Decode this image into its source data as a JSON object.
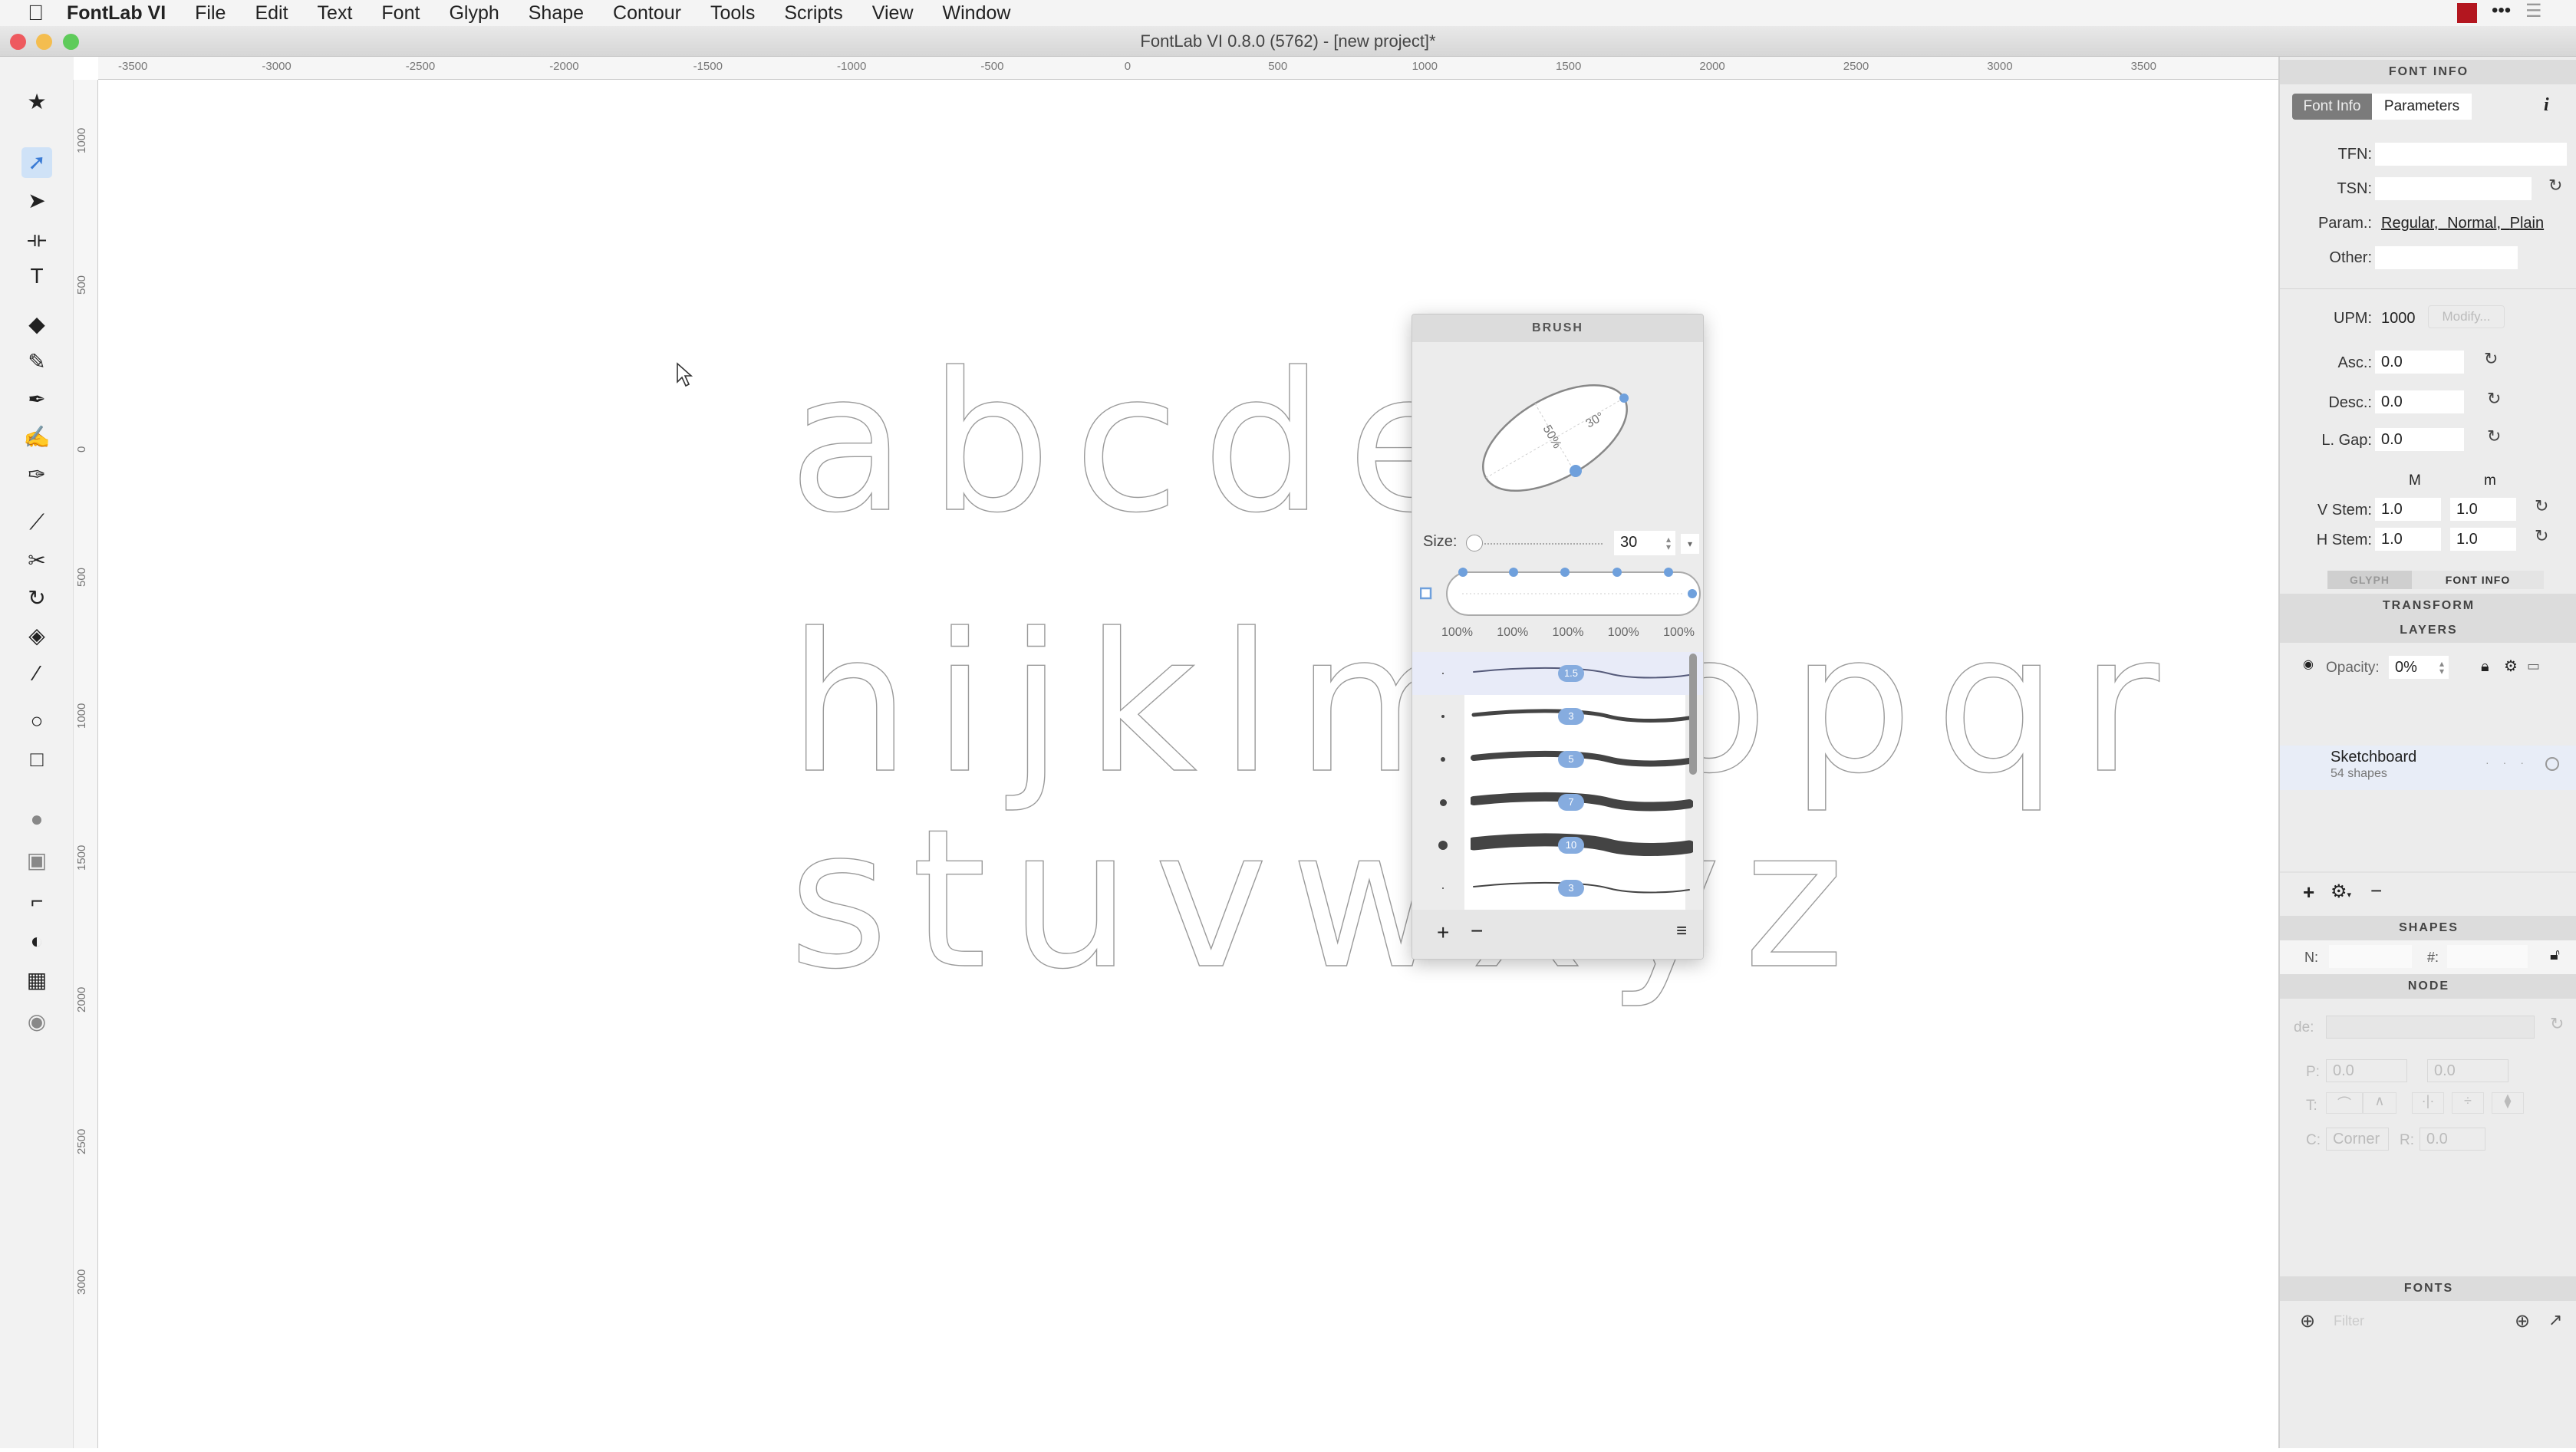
{
  "menubar": {
    "app": "FontLab VI",
    "items": [
      "File",
      "Edit",
      "Text",
      "Font",
      "Glyph",
      "Shape",
      "Contour",
      "Tools",
      "Scripts",
      "View",
      "Window"
    ]
  },
  "window": {
    "title": "FontLab VI 0.8.0 (5762) - [new project]*"
  },
  "rulers": {
    "horizontal": [
      "-3500",
      "-3000",
      "-2500",
      "-2000",
      "-1500",
      "-1000",
      "-500",
      "0",
      "500",
      "1000",
      "1500",
      "2000",
      "2500",
      "3000",
      "3500"
    ],
    "vertical": [
      "1000",
      "500",
      "0",
      "500",
      "1000",
      "1500",
      "2000",
      "2500",
      "3000"
    ]
  },
  "toolbar": {
    "tools": [
      {
        "icon": "star-icon",
        "glyph": "★"
      },
      {
        "icon": "pointer-icon",
        "glyph": "➚",
        "selected": true
      },
      {
        "icon": "contour-pointer-icon",
        "glyph": "➤"
      },
      {
        "icon": "measure-icon",
        "glyph": "⟛"
      },
      {
        "icon": "text-icon",
        "glyph": "T"
      },
      {
        "icon": "eraser-icon",
        "glyph": "◆"
      },
      {
        "icon": "brush-icon",
        "glyph": "✎"
      },
      {
        "icon": "pen-icon",
        "glyph": "✒"
      },
      {
        "icon": "rapid-pen-icon",
        "glyph": "✍"
      },
      {
        "icon": "power-pen-icon",
        "glyph": "✑"
      },
      {
        "icon": "knife-icon",
        "glyph": "⟋"
      },
      {
        "icon": "scissors-icon",
        "glyph": "✂"
      },
      {
        "icon": "rotate-icon",
        "glyph": "↻"
      },
      {
        "icon": "fill-icon",
        "glyph": "◈"
      },
      {
        "icon": "eyedropper-icon",
        "glyph": "⁄"
      },
      {
        "icon": "ellipse-icon",
        "glyph": "○"
      },
      {
        "icon": "rectangle-icon",
        "glyph": "□"
      },
      {
        "icon": "color-icon",
        "glyph": "●"
      },
      {
        "icon": "component-icon",
        "glyph": "▣"
      },
      {
        "icon": "corner-icon",
        "glyph": "⌐"
      },
      {
        "icon": "yin-yang-icon",
        "glyph": "◐"
      },
      {
        "icon": "grid-icon",
        "glyph": "▦"
      },
      {
        "icon": "hand-icon",
        "glyph": "◉"
      }
    ]
  },
  "canvas": {
    "rows": [
      "abcdefg",
      "hijklmnopqr",
      "stuvwxyz"
    ]
  },
  "brush_panel": {
    "title": "BRUSH",
    "angle": "30°",
    "ratio": "50%",
    "size_label": "Size:",
    "size_value": "30",
    "pressure": [
      "100%",
      "100%",
      "100%",
      "100%",
      "100%"
    ],
    "brushes": [
      {
        "value": "1.5",
        "selected": true
      },
      {
        "value": "3"
      },
      {
        "value": "5"
      },
      {
        "value": "7"
      },
      {
        "value": "10"
      },
      {
        "value": "3"
      }
    ],
    "accent": "#6fa0dc"
  },
  "right_panel": {
    "font_info": {
      "header": "FONT INFO",
      "tabs": [
        "Font Info",
        "Parameters"
      ],
      "info_icon": "i",
      "tfn_label": "TFN:",
      "tsn_label": "TSN:",
      "param_label": "Param.:",
      "param_values": [
        "Regular,",
        "Normal,",
        "Plain"
      ],
      "other_label": "Other:",
      "upm_label": "UPM:",
      "upm_value": "1000",
      "modify": "Modify...",
      "asc_label": "Asc.:",
      "asc": "0.0",
      "desc_label": "Desc.:",
      "desc": "0.0",
      "lgap_label": "L. Gap:",
      "lgap": "0.0",
      "col_M": "M",
      "col_m": "m",
      "vstem_label": "V Stem:",
      "vstem_M": "1.0",
      "vstem_m": "1.0",
      "hstem_label": "H Stem:",
      "hstem_M": "1.0",
      "hstem_m": "1.0",
      "bottom_tabs": [
        "GLYPH",
        "FONT INFO"
      ]
    },
    "transform": "TRANSFORM",
    "layers": {
      "header": "LAYERS",
      "opacity_label": "Opacity:",
      "opacity": "0%",
      "layer_name": "Sketchboard",
      "layer_count": "54 shapes"
    },
    "shapes": {
      "header": "SHAPES",
      "n_label": "N:",
      "hash_label": "#:"
    },
    "node": {
      "header": "NODE",
      "de_label": "de:",
      "p_label": "P:",
      "p_x": "0.0",
      "p_y": "0.0",
      "t_label": "T:",
      "c_label": "C:",
      "corner": "Corner",
      "r_label": "R:",
      "r_value": "0.0"
    },
    "fonts": {
      "header": "FONTS",
      "filter_placeholder": "Filter"
    }
  }
}
